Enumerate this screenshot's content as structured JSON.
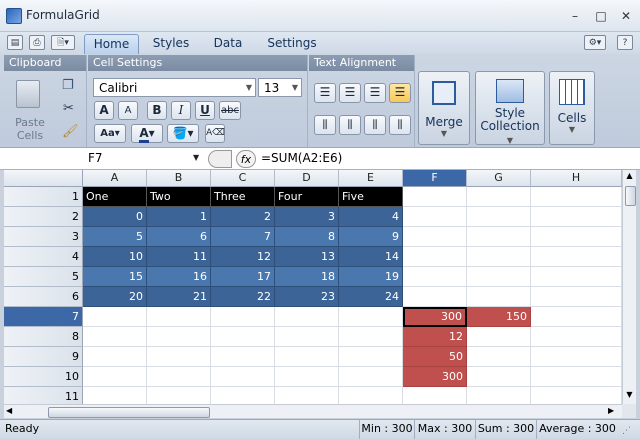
{
  "window": {
    "title": "FormulaGrid",
    "controls": {
      "minimize": "–",
      "maximize": "□",
      "close": "✕"
    }
  },
  "quick_access": {
    "icons": [
      "print-icon",
      "printer-icon",
      "page-preview-icon"
    ]
  },
  "ribbon": {
    "tabs": [
      "Home",
      "Styles",
      "Data",
      "Settings"
    ],
    "groups": {
      "clipboard": {
        "title": "Clipboard",
        "paste_label": "Paste",
        "cells_label": "Cells"
      },
      "cell_settings": {
        "title": "Cell Settings",
        "font": "Calibri",
        "size": "13",
        "bold": "B",
        "italic": "I",
        "underline": "U",
        "strike": "abc",
        "grow": "A",
        "shrink": "A"
      },
      "text_alignment": {
        "title": "Text Alignment"
      },
      "merge": {
        "label": "Merge"
      },
      "style": {
        "label1": "Style",
        "label2": "Collection"
      },
      "cells": {
        "label": "Cells"
      }
    }
  },
  "formula_bar": {
    "name_box": "F7",
    "fx": "fx",
    "formula": "=SUM(A2:E6)"
  },
  "sheet": {
    "columns": [
      "A",
      "B",
      "C",
      "D",
      "E",
      "F",
      "G",
      "H"
    ],
    "rows": [
      {
        "n": "1",
        "cells": [
          "One",
          "Two",
          "Three",
          "Four",
          "Five",
          "",
          "",
          ""
        ]
      },
      {
        "n": "2",
        "cells": [
          "0",
          "1",
          "2",
          "3",
          "4",
          "",
          "",
          ""
        ]
      },
      {
        "n": "3",
        "cells": [
          "5",
          "6",
          "7",
          "8",
          "9",
          "",
          "",
          ""
        ]
      },
      {
        "n": "4",
        "cells": [
          "10",
          "11",
          "12",
          "13",
          "14",
          "",
          "",
          ""
        ]
      },
      {
        "n": "5",
        "cells": [
          "15",
          "16",
          "17",
          "18",
          "19",
          "",
          "",
          ""
        ]
      },
      {
        "n": "6",
        "cells": [
          "20",
          "21",
          "22",
          "23",
          "24",
          "",
          "",
          ""
        ]
      },
      {
        "n": "7",
        "cells": [
          "",
          "",
          "",
          "",
          "",
          "300",
          "150",
          ""
        ]
      },
      {
        "n": "8",
        "cells": [
          "",
          "",
          "",
          "",
          "",
          "12",
          "",
          ""
        ]
      },
      {
        "n": "9",
        "cells": [
          "",
          "",
          "",
          "",
          "",
          "50",
          "",
          ""
        ]
      },
      {
        "n": "10",
        "cells": [
          "",
          "",
          "",
          "",
          "",
          "300",
          "",
          ""
        ]
      },
      {
        "n": "11",
        "cells": [
          "",
          "",
          "",
          "",
          "",
          "",
          "",
          ""
        ]
      }
    ],
    "active_cell": "F7",
    "colors": {
      "header_row": "#000000",
      "data_blue": "#3c6496",
      "data_blue_light": "#4a78ae",
      "red_fill": "#c0504d",
      "selection_header": "#3c68a8"
    }
  },
  "status": {
    "ready": "Ready",
    "min": "Min : 300",
    "max": "Max : 300",
    "sum": "Sum : 300",
    "avg": "Average : 300"
  }
}
